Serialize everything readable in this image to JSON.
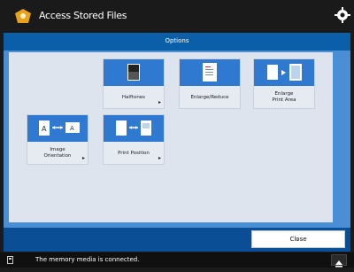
{
  "header": {
    "title": "Access Stored Files"
  },
  "options_bar": {
    "label": "Options"
  },
  "buttons": [
    {
      "id": "halftones",
      "label": "Halftones"
    },
    {
      "id": "enlarge",
      "label": "Enlarge/Reduce"
    },
    {
      "id": "enlarge-print-area",
      "label": "Enlarge\nPrint Area"
    },
    {
      "id": "image-orientation",
      "label": "Image\nOrientation"
    },
    {
      "id": "print-position",
      "label": "Print Position"
    }
  ],
  "footer": {
    "close_label": "Close"
  },
  "status": {
    "message": "The memory media is connected."
  },
  "colors": {
    "accent": "#0a5fa8",
    "icon_bg": "#2f7ad0",
    "panel": "#4a8fd6"
  }
}
